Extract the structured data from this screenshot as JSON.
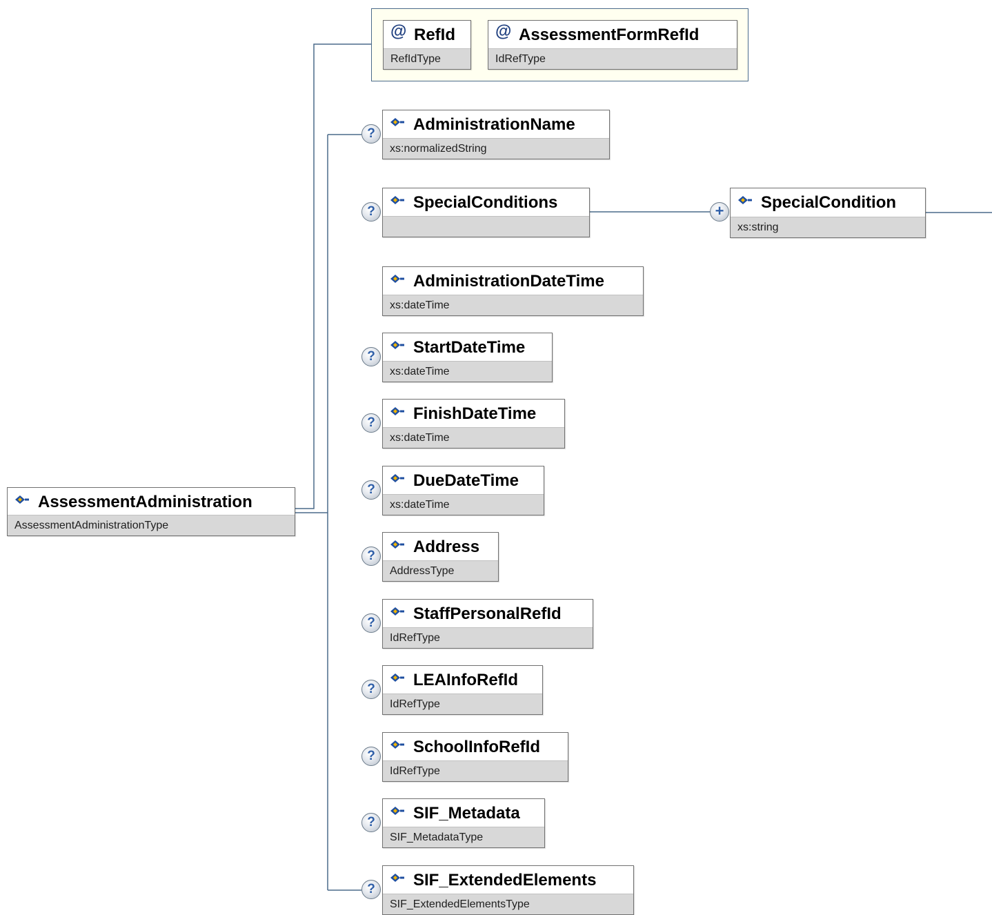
{
  "root": {
    "name": "AssessmentAdministration",
    "type": "AssessmentAdministrationType",
    "icon": "element-icon"
  },
  "attributes": [
    {
      "name": "RefId",
      "type": "RefIdType",
      "icon": "attribute-at-icon"
    },
    {
      "name": "AssessmentFormRefId",
      "type": "IdRefType",
      "icon": "attribute-at-icon"
    }
  ],
  "elements": [
    {
      "name": "AdministrationName",
      "type": "xs:normalizedString",
      "optional": true
    },
    {
      "name": "SpecialConditions",
      "type": "",
      "optional": true
    },
    {
      "name": "AdministrationDateTime",
      "type": "xs:dateTime",
      "optional": false
    },
    {
      "name": "StartDateTime",
      "type": "xs:dateTime",
      "optional": true
    },
    {
      "name": "FinishDateTime",
      "type": "xs:dateTime",
      "optional": true
    },
    {
      "name": "DueDateTime",
      "type": "xs:dateTime",
      "optional": true
    },
    {
      "name": "Address",
      "type": "AddressType",
      "optional": true
    },
    {
      "name": "StaffPersonalRefId",
      "type": "IdRefType",
      "optional": true
    },
    {
      "name": "LEAInfoRefId",
      "type": "IdRefType",
      "optional": true
    },
    {
      "name": "SchoolInfoRefId",
      "type": "IdRefType",
      "optional": true
    },
    {
      "name": "SIF_Metadata",
      "type": "SIF_MetadataType",
      "optional": true
    },
    {
      "name": "SIF_ExtendedElements",
      "type": "SIF_ExtendedElementsType",
      "optional": true
    }
  ],
  "child": {
    "name": "SpecialCondition",
    "type": "xs:string",
    "cardinality_marker": "+"
  },
  "badges": {
    "optional_marker": "?"
  },
  "colors": {
    "connector": "#4a6a8a",
    "type_band": "#d8d8d8",
    "attr_group_bg": "#fffff0",
    "icon_blue": "#1f4fa0",
    "icon_yellow": "#f0b400"
  }
}
